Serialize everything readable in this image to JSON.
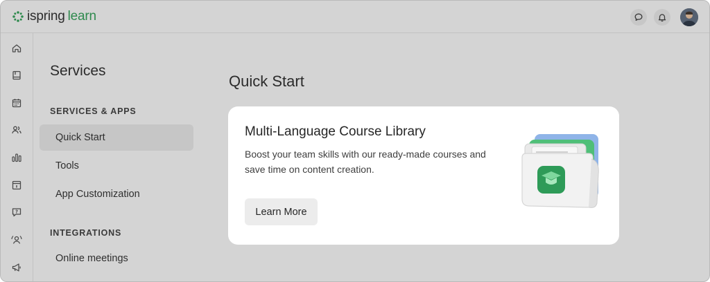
{
  "app": {
    "logo_text_1": "ispring",
    "logo_text_2": "learn"
  },
  "topbar": {
    "icons": [
      "chat-bubble-icon",
      "bell-icon",
      "user-avatar"
    ]
  },
  "rail": {
    "icons": [
      "home-icon",
      "book-icon",
      "calendar-icon",
      "users-icon",
      "bar-chart-icon",
      "info-box-icon",
      "question-bubble-icon",
      "user-gear-icon",
      "megaphone-icon"
    ]
  },
  "sidebar": {
    "title": "Services",
    "sections": [
      {
        "heading": "SERVICES & APPS",
        "items": [
          {
            "label": "Quick Start",
            "active": true
          },
          {
            "label": "Tools",
            "active": false
          },
          {
            "label": "App Customization",
            "active": false
          }
        ]
      },
      {
        "heading": "INTEGRATIONS",
        "items": [
          {
            "label": "Online meetings",
            "active": false
          }
        ]
      }
    ]
  },
  "main": {
    "title": "Quick Start",
    "card": {
      "title": "Multi-Language Course Library",
      "description": "Boost your team skills with our ready-made courses and save time on content creation.",
      "button_label": "Learn More",
      "illustration": "course-folder-graduation-cap"
    }
  },
  "colors": {
    "brand_green": "#2f8a4e",
    "background": "#d4d4d4",
    "card": "#ffffff",
    "active_nav": "#c6c6c6"
  }
}
